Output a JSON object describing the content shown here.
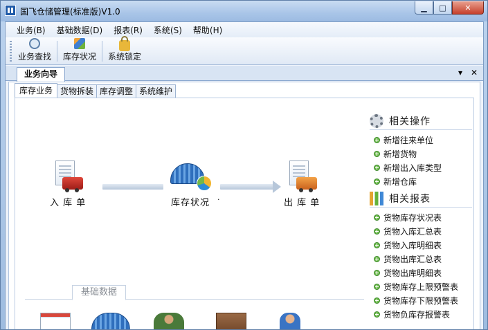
{
  "window": {
    "title": "国飞仓储管理(标准版)V1.0",
    "buttons": {
      "minimize": "▁",
      "maximize": "□",
      "close": "✕"
    }
  },
  "menu": {
    "items": [
      {
        "label": "业务(B)"
      },
      {
        "label": "基础数据(D)"
      },
      {
        "label": "报表(R)"
      },
      {
        "label": "系统(S)"
      },
      {
        "label": "帮助(H)"
      }
    ]
  },
  "toolbar": {
    "search": "业务查找",
    "stock": "库存状况",
    "lock": "系统锁定"
  },
  "doc_tab": {
    "label": "业务向导",
    "dropdown": "▾",
    "close": "✕"
  },
  "subtabs": [
    {
      "label": "库存业务"
    },
    {
      "label": "货物拆装"
    },
    {
      "label": "库存调整"
    },
    {
      "label": "系统维护"
    }
  ],
  "flow": {
    "inbound": "入 库 单",
    "stock": "库存状况",
    "outbound": "出 库 单",
    "dot": "·"
  },
  "related_ops": {
    "title": "相关操作",
    "items": [
      "新增往来单位",
      "新增货物",
      "新增出入库类型",
      "新增仓库"
    ]
  },
  "related_reports": {
    "title": "相关报表",
    "items": [
      "货物库存状况表",
      "货物入库汇总表",
      "货物入库明细表",
      "货物出库汇总表",
      "货物出库明细表",
      "货物库存上限预警表",
      "货物库存下限预警表",
      "货物负库存报警表"
    ]
  },
  "basic": {
    "title": "基础数据"
  }
}
